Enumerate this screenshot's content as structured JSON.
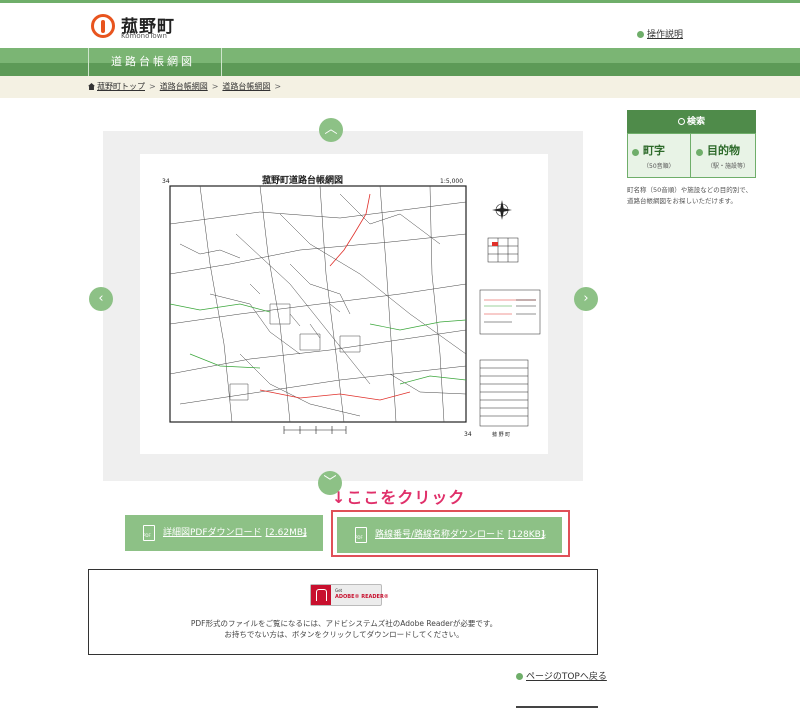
{
  "header": {
    "logo_text": "菰野町",
    "logo_sub": "KomonoTown",
    "help_link": "操作説明",
    "section_title": "道路台帳網図"
  },
  "breadcrumb": {
    "items": [
      "菰野町トップ",
      "道路台帳網図",
      "道路台帳網図"
    ],
    "trailing": ">"
  },
  "viewer": {
    "map": {
      "title": "菰野町道路台帳網図",
      "scale": "1:5,000",
      "sheet_no_top": "34",
      "sheet_no_bottom": "34",
      "town": "菰 野 町"
    },
    "nav_up": "︿",
    "nav_down": "﹀",
    "nav_prev": "‹",
    "nav_next": "›"
  },
  "hint": "↓ここをクリック",
  "downloads": [
    {
      "label": "詳細図PDFダウンロード",
      "size": "[2.62MB]",
      "icon": "download-arrow-icon"
    },
    {
      "label": "路線番号/路線名称ダウンロード",
      "size": "[128KB]",
      "icon": "download-arrow-icon"
    }
  ],
  "adobe": {
    "badge_top": "Get",
    "badge_name": "ADOBE® READER®",
    "line1": "PDF形式のファイルをご覧になるには、アドビシステムズ社のAdobe Readerが必要です。",
    "line2": "お持ちでない方は、ボタンをクリックしてダウンロードしてください。"
  },
  "to_top": "ページのTOPへ戻る",
  "side": {
    "title": "検索",
    "col1": {
      "big": "町字",
      "small": "（50音順）"
    },
    "col2": {
      "big": "目的物",
      "small": "（駅・施設等）"
    },
    "note": "町名称（50音順）や施設などの目的別で、道路台帳網図をお探しいただけます。"
  },
  "colors": {
    "accent": "#8dc186",
    "dark_green": "#4f8b4a",
    "hint_red": "#e0306a"
  }
}
